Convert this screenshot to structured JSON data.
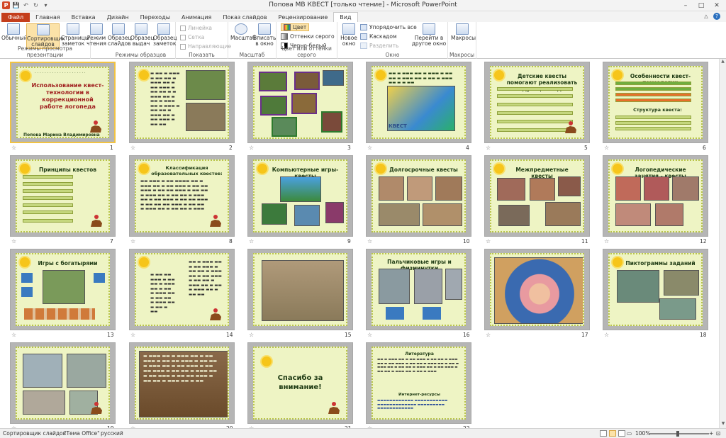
{
  "window": {
    "title": "Попова МВ КВЕСТ [только чтение] - Microsoft PowerPoint",
    "minimize": "–",
    "maximize": "□",
    "close": "✕"
  },
  "ribbon_tabs": [
    "Файл",
    "Главная",
    "Вставка",
    "Дизайн",
    "Переходы",
    "Анимация",
    "Показ слайдов",
    "Рецензирование",
    "Вид"
  ],
  "active_tab": "Вид",
  "ribbon": {
    "presentation_views": {
      "label": "Режимы просмотра презентации",
      "buttons": [
        "Обычный",
        "Сортировщик слайдов",
        "Страницы заметок",
        "Режим чтения"
      ]
    },
    "master_views": {
      "label": "Режимы образцов",
      "buttons": [
        "Образец слайдов",
        "Образец выдач",
        "Образец заметок"
      ]
    },
    "show": {
      "label": "Показать",
      "items": [
        "Линейка",
        "Сетка",
        "Направляющие"
      ]
    },
    "zoom": {
      "label": "Масштаб",
      "buttons": [
        "Масштаб",
        "Вписать в окно"
      ]
    },
    "color": {
      "label": "Цвет или оттенки серого",
      "items": [
        "Цвет",
        "Оттенки серого",
        "Черно-белый"
      ]
    },
    "window": {
      "label": "Окно",
      "new_window": "Новое окно",
      "items": [
        "Упорядочить все",
        "Каскадом",
        "Разделить"
      ],
      "switch": "Перейти в другое окно"
    },
    "macros": {
      "label": "Макросы",
      "button": "Макросы"
    }
  },
  "slides": [
    {
      "n": "1",
      "title": "Использование квест-технологии в коррекционной работе логопеда",
      "author": "Попова Марина Владимировна"
    },
    {
      "n": "2",
      "title": ""
    },
    {
      "n": "3",
      "title": ""
    },
    {
      "n": "4",
      "title": "",
      "badge": "КВЕСТ"
    },
    {
      "n": "5",
      "title": "Детские квесты помогают реализовать следующие задачи"
    },
    {
      "n": "6",
      "title": "Особенности квест-технологии",
      "subtitle": "Структура квеста:"
    },
    {
      "n": "7",
      "title": "Принципы квестов"
    },
    {
      "n": "8",
      "title": "Классификация образовательных квестов:"
    },
    {
      "n": "9",
      "title": "Компьютерные игры-квесты"
    },
    {
      "n": "10",
      "title": "Долгосрочные квесты"
    },
    {
      "n": "11",
      "title": "Межпредметные квесты"
    },
    {
      "n": "12",
      "title": "Логопедические занятия - квесты"
    },
    {
      "n": "13",
      "title": "Игры с богатырями"
    },
    {
      "n": "14",
      "title": ""
    },
    {
      "n": "15",
      "title": ""
    },
    {
      "n": "16",
      "title": "Пальчиковые игры и физминутки"
    },
    {
      "n": "17",
      "title": ""
    },
    {
      "n": "18",
      "title": "Пиктограммы заданий"
    },
    {
      "n": "19",
      "title": ""
    },
    {
      "n": "20",
      "title": ""
    },
    {
      "n": "21",
      "title": "Спасибо за внимание!"
    },
    {
      "n": "22",
      "title": "Литература",
      "subtitle": "Интернет-ресурсы"
    }
  ],
  "status": {
    "view": "Сортировщик слайдов",
    "theme": "\"Тема Office\"",
    "language": "русский",
    "zoom": "100%"
  },
  "colors": {
    "accent_file_tab": "#c43e1c",
    "slide_bg": "#eef4c4",
    "title_red": "#a02020",
    "title_dark_green": "#1f3b14"
  }
}
